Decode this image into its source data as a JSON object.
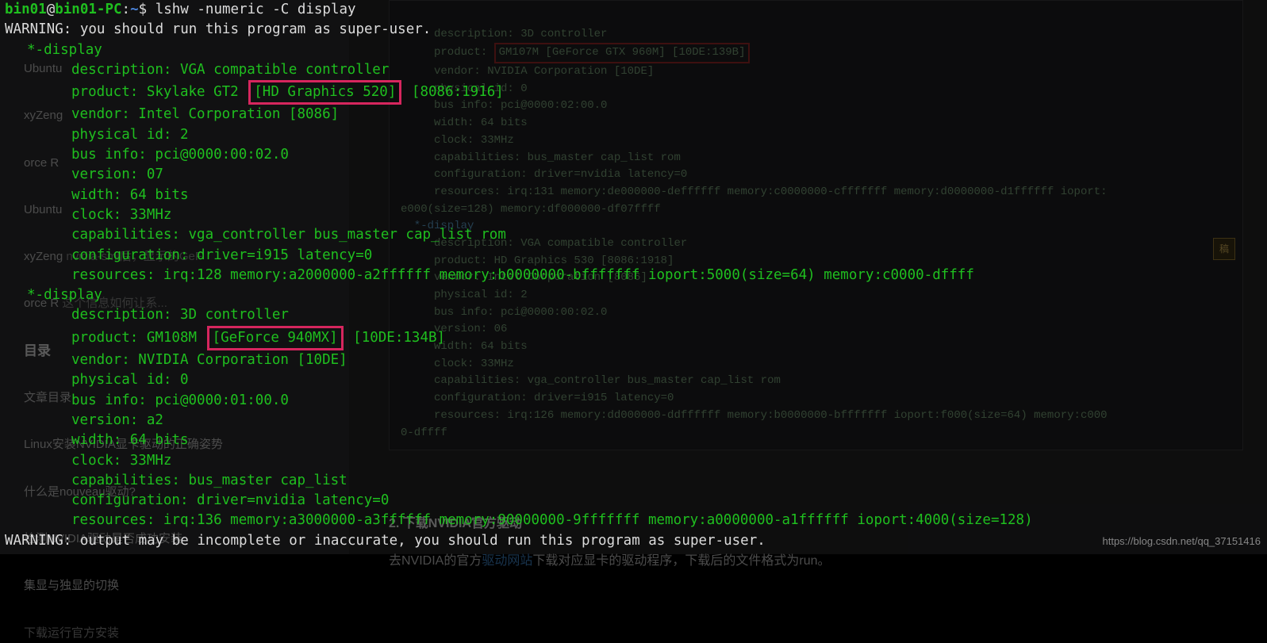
{
  "prompt": {
    "user": "bin01",
    "host": "bin01-PC",
    "path": "~",
    "command": "lshw -numeric -C display"
  },
  "warning_top": "WARNING: you should run this program as super-user.",
  "warning_bottom": "WARNING: output may be incomplete or inaccurate, you should run this program as super-user.",
  "display1": {
    "header": "*-display",
    "description": "description: VGA compatible controller",
    "product_pre": "product: Skylake GT2 ",
    "product_box": "[HD Graphics 520]",
    "product_post": " [8086:1916]",
    "vendor": "vendor: Intel Corporation [8086]",
    "physical_id": "physical id: 2",
    "bus_info": "bus info: pci@0000:00:02.0",
    "version": "version: 07",
    "width": "width: 64 bits",
    "clock": "clock: 33MHz",
    "capabilities": "capabilities: vga_controller bus_master cap_list rom",
    "configuration": "configuration: driver=i915 latency=0",
    "resources": "resources: irq:128 memory:a2000000-a2ffffff memory:b0000000-bfffffff ioport:5000(size=64) memory:c0000-dffff"
  },
  "display2": {
    "header": "*-display",
    "description": "description: 3D controller",
    "product_pre": "product: GM108M ",
    "product_box": "[GeForce 940MX]",
    "product_post": " [10DE:134B]",
    "vendor": "vendor: NVIDIA Corporation [10DE]",
    "physical_id": "physical id: 0",
    "bus_info": "bus info: pci@0000:01:00.0",
    "version": "version: a2",
    "width": "width: 64 bits",
    "clock": "clock: 33MHz",
    "capabilities": "capabilities: bus_master cap_list",
    "configuration": "configuration: driver=nvidia latency=0",
    "resources": "resources: irq:136 memory:a3000000-a3ffffff memory:90000000-9fffffff memory:a0000000-a1ffffff ioport:4000(size=128)"
  },
  "bg": {
    "sidebar": {
      "items": [
        "Ubuntu",
        "xyZeng",
        "orce R",
        "Ubuntu",
        "xyZeng",
        "orce R"
      ],
      "subtext1": "nvidia-smi后，显示的GeF",
      "subtext2": "这个信息如何让系...",
      "toc_title": "目录",
      "toc": [
        "文章目录",
        "Linux安装NVIDIA显卡驱动的正确姿势",
        "什么是nouveau驱动?",
        "检测NVIDIA驱动是否成功安装",
        "集显与独显的切换"
      ],
      "subtext3": "下载运行官方安装"
    },
    "code": {
      "l0": "     description: 3D controller",
      "l1_pre": "     product: ",
      "l1_box": "GM107M [GeForce GTX 960M] [10DE:139B]",
      "l2": "     vendor: NVIDIA Corporation [10DE]",
      "l3": "     physical id: 0",
      "l4": "     bus info: pci@0000:02:00.0",
      "l5": "     width: 64 bits",
      "l6": "     clock: 33MHz",
      "l7": "     capabilities: bus_master cap_list rom",
      "l8": "     configuration: driver=nvidia latency=0",
      "l9": "     resources: irq:131 memory:de000000-deffffff memory:c0000000-cfffffff memory:d0000000-d1ffffff ioport:",
      "l9b": "e000(size=128) memory:df000000-df07ffff",
      "l10": "  *-display",
      "l11": "     description: VGA compatible controller",
      "l12": "     product: HD Graphics 530 [8086:1918]",
      "l13": "     vendor: Intel Corporation [8086]",
      "l14": "     physical id: 2",
      "l15": "     bus info: pci@0000:00:02.0",
      "l16": "     version: 06",
      "l17": "     width: 64 bits",
      "l18": "     clock: 33MHz",
      "l19": "     capabilities: vga_controller bus_master cap_list rom",
      "l20": "     configuration: driver=i915 latency=0",
      "l21": "     resources: irq:126 memory:dd000000-ddffffff memory:b0000000-bfffffff ioport:f000(size=64) memory:c000",
      "l22": "0-dffff"
    },
    "section_h": "2. 下载NVIDIA官方驱动",
    "section_p_pre": "去NVIDIA的官方",
    "section_p_link": "驱动网站",
    "section_p_post": "下载对应显卡的驱动程序，下载后的文件格式为run。",
    "badge": "稿"
  },
  "watermark": "https://blog.csdn.net/qq_37151416"
}
